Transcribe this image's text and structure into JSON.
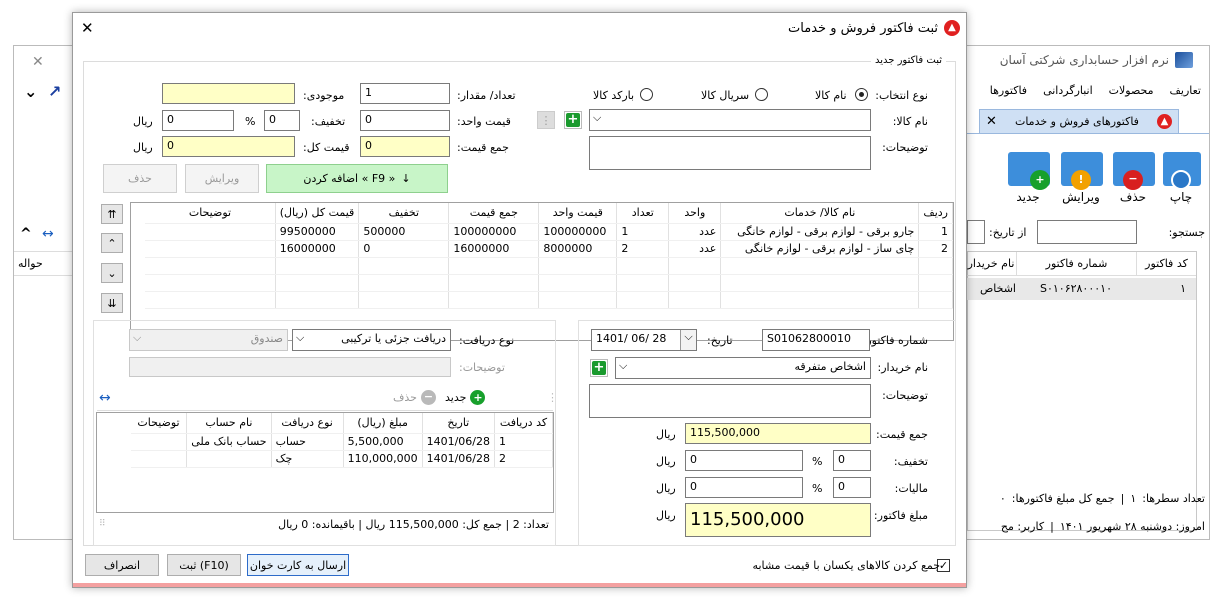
{
  "bg_window": {
    "title": "نرم افزار حسابداری شرکتی آسان",
    "menu": [
      "تعاریف",
      "محصولات",
      "انبارگردانی",
      "فاکتورها"
    ],
    "tab_label": "فاکتورهای فروش و خدمات",
    "toolbar": [
      "جدید",
      "ویرایش",
      "حذف",
      "چاپ"
    ],
    "search_label": "جستجو:",
    "from_date_label": "از تاریخ:",
    "grid_headers": [
      "کد فاکتور",
      "شماره فاکتور",
      "نام خریدار"
    ],
    "grid_row": {
      "code": "۱",
      "number": "S۰۱۰۶۲۸۰۰۰۱۰",
      "buyer": "اشخاص"
    },
    "left_header": "حواله",
    "status_rows_label": "تعداد سطرها:",
    "status_rows_value": "۱",
    "status_total_label": "جمع کل مبلغ فاکتورها:",
    "status_total_value": "۰",
    "status_today": "امروز: دوشنبه ۲۸ شهریور ۱۴۰۱",
    "status_user": "کاربر: مح"
  },
  "dialog": {
    "title": "ثبت فاکتور فروش و خدمات",
    "group_title": "ثبت فاکتور جدید",
    "select_type_label": "نوع انتخاب:",
    "radio_name": "نام کالا",
    "radio_serial": "سریال کالا",
    "radio_barcode": "بارکد کالا",
    "item_name_label": "نام کالا:",
    "desc_label": "توضیحات:",
    "qty_label": "تعداد/ مقدار:",
    "qty_value": "1",
    "stock_label": "موجودی:",
    "stock_value": "",
    "unit_price_label": "قیمت واحد:",
    "unit_price_value": "0",
    "discount_label": "تخفیف:",
    "discount_pct": "0",
    "discount_value": "0",
    "pct_sign": "%",
    "rial": "ریال",
    "sum_label": "جمع قیمت:",
    "sum_value": "0",
    "total_price_label": "قیمت کل:",
    "total_price_value": "0",
    "add_button": "اضافه کردن « F9 »",
    "edit_button": "ویرایش",
    "delete_button": "حذف",
    "items_headers": [
      "ردیف",
      "نام کالا/ خدمات",
      "واحد",
      "تعداد",
      "قیمت واحد",
      "جمع قیمت",
      "تخفیف",
      "قیمت کل (ریال)",
      "توضیحات"
    ],
    "items": [
      {
        "row": "1",
        "name": "جارو برقی - لوازم برقی - لوازم خانگی",
        "unit": "عدد",
        "qty": "1",
        "unit_price": "100000000",
        "sum": "100000000",
        "discount": "500000",
        "total": "99500000",
        "desc": ""
      },
      {
        "row": "2",
        "name": "چای ساز - لوازم برقی - لوازم خانگی",
        "unit": "عدد",
        "qty": "2",
        "unit_price": "8000000",
        "sum": "16000000",
        "discount": "0",
        "total": "16000000",
        "desc": ""
      }
    ],
    "invoice_no_label": "شماره فاکتور:",
    "invoice_no_value": "S01062800010",
    "date_label": "تاریخ:",
    "date_value": "1401/ 06/ 28",
    "buyer_label": "نام خریدار:",
    "buyer_value": "اشخاص متفرقه",
    "desc2_label": "توضیحات:",
    "total_sum_label": "جمع قیمت:",
    "total_sum_value": "115,500,000",
    "inv_discount_label": "تخفیف:",
    "inv_discount_pct": "0",
    "inv_discount_value": "0",
    "tax_label": "مالیات:",
    "tax_pct": "0",
    "tax_value": "0",
    "invoice_amount_label": "مبلغ فاکتور:",
    "invoice_amount_value": "115,500,000",
    "receipt_type_label": "نوع دریافت:",
    "receipt_type_value": "دریافت جزئی یا ترکیبی",
    "cashbox_value": "صندوق",
    "receipt_desc_label": "توضیحات:",
    "new_label": "جدید",
    "del_label": "حذف",
    "payments_headers": [
      "کد دریافت",
      "تاریخ",
      "مبلغ (ریال)",
      "نوع دریافت",
      "نام حساب",
      "توضیحات"
    ],
    "payments": [
      {
        "code": "1",
        "date": "1401/06/28",
        "amount": "5,500,000",
        "type": "حساب",
        "account": "حساب بانک ملی",
        "desc": ""
      },
      {
        "code": "2",
        "date": "1401/06/28",
        "amount": "110,000,000",
        "type": "چک",
        "account": "",
        "desc": ""
      }
    ],
    "pay_status": "تعداد:  2  |  جمع کل: 115,500,000 ریال  |  باقیمانده: 0 ریال",
    "merge_checkbox_label": "جمع کردن کالاهای یکسان با قیمت مشابه",
    "cancel_button": "انصراف",
    "save_button": "ثبت (F10)",
    "send_button": "ارسال به کارت خوان"
  }
}
